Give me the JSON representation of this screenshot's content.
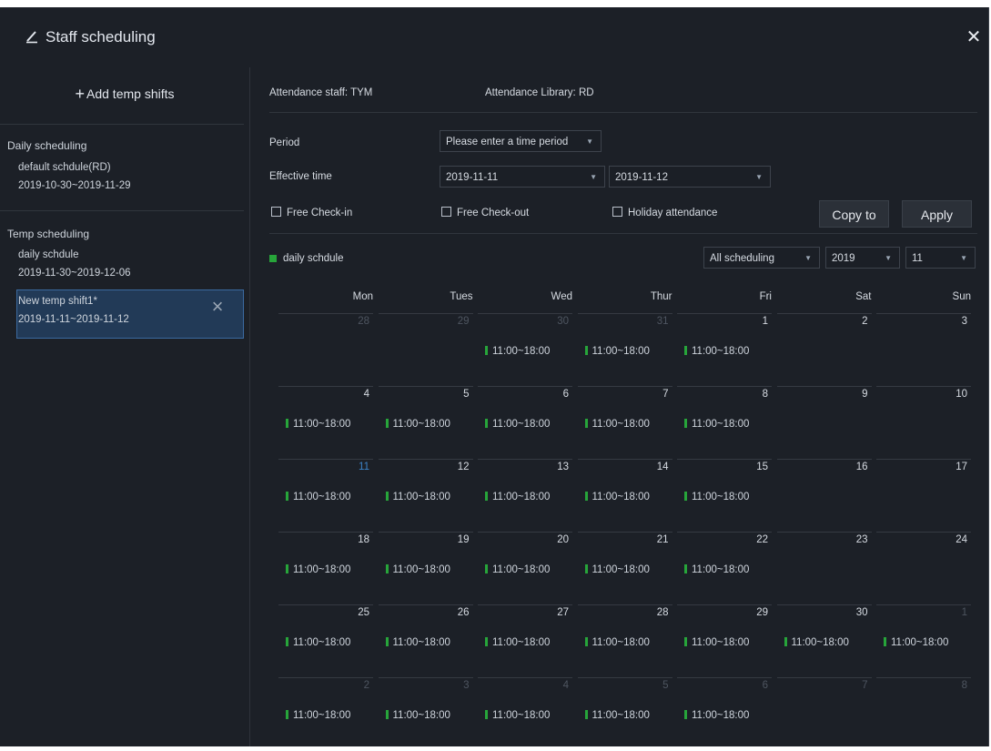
{
  "window": {
    "title": "Staff scheduling",
    "close_icon": "close-icon",
    "title_icon": "edit-icon"
  },
  "sidebar": {
    "add_temp_label": "Add temp shifts",
    "daily_heading": "Daily scheduling",
    "daily_items": [
      {
        "name": "default schdule(RD)",
        "range": "2019-10-30~2019-11-29"
      }
    ],
    "temp_heading": "Temp scheduling",
    "temp_items": [
      {
        "name": "daily schdule",
        "range": "2019-11-30~2019-12-06"
      },
      {
        "name": "New temp shift1*",
        "range": "2019-11-11~2019-11-12",
        "selected": true
      }
    ]
  },
  "main": {
    "attendance_staff_label": "Attendance staff:",
    "attendance_staff_value": "TYM",
    "attendance_library_label": "Attendance Library:",
    "attendance_library_value": "RD",
    "period_label": "Period",
    "period_placeholder": "Please enter a time period",
    "effective_label": "Effective time",
    "effective_start": "2019-11-11",
    "effective_end": "2019-11-12",
    "free_checkin": "Free Check-in",
    "free_checkout": "Free Check-out",
    "holiday_attendance": "Holiday attendance",
    "copy_to": "Copy to",
    "apply": "Apply",
    "legend_label": "daily schdule",
    "filter_scheduling": "All scheduling",
    "filter_year": "2019",
    "filter_month": "11",
    "accent_color": "#27a53a",
    "today_color": "#3c83c8"
  },
  "calendar": {
    "weekdays": [
      "Mon",
      "Tues",
      "Wed",
      "Thur",
      "Fri",
      "Sat",
      "Sun"
    ],
    "weeks": [
      [
        {
          "day": "28",
          "other": true,
          "shift": ""
        },
        {
          "day": "29",
          "other": true,
          "shift": ""
        },
        {
          "day": "30",
          "other": true,
          "shift": "11:00~18:00"
        },
        {
          "day": "31",
          "other": true,
          "shift": "11:00~18:00"
        },
        {
          "day": "1",
          "other": false,
          "shift": "11:00~18:00"
        },
        {
          "day": "2",
          "other": false,
          "shift": ""
        },
        {
          "day": "3",
          "other": false,
          "shift": ""
        }
      ],
      [
        {
          "day": "4",
          "other": false,
          "shift": "11:00~18:00"
        },
        {
          "day": "5",
          "other": false,
          "shift": "11:00~18:00"
        },
        {
          "day": "6",
          "other": false,
          "shift": "11:00~18:00"
        },
        {
          "day": "7",
          "other": false,
          "shift": "11:00~18:00"
        },
        {
          "day": "8",
          "other": false,
          "shift": "11:00~18:00"
        },
        {
          "day": "9",
          "other": false,
          "shift": ""
        },
        {
          "day": "10",
          "other": false,
          "shift": ""
        }
      ],
      [
        {
          "day": "11",
          "other": false,
          "today": true,
          "shift": "11:00~18:00"
        },
        {
          "day": "12",
          "other": false,
          "shift": "11:00~18:00"
        },
        {
          "day": "13",
          "other": false,
          "shift": "11:00~18:00"
        },
        {
          "day": "14",
          "other": false,
          "shift": "11:00~18:00"
        },
        {
          "day": "15",
          "other": false,
          "shift": "11:00~18:00"
        },
        {
          "day": "16",
          "other": false,
          "shift": ""
        },
        {
          "day": "17",
          "other": false,
          "shift": ""
        }
      ],
      [
        {
          "day": "18",
          "other": false,
          "shift": "11:00~18:00"
        },
        {
          "day": "19",
          "other": false,
          "shift": "11:00~18:00"
        },
        {
          "day": "20",
          "other": false,
          "shift": "11:00~18:00"
        },
        {
          "day": "21",
          "other": false,
          "shift": "11:00~18:00"
        },
        {
          "day": "22",
          "other": false,
          "shift": "11:00~18:00"
        },
        {
          "day": "23",
          "other": false,
          "shift": ""
        },
        {
          "day": "24",
          "other": false,
          "shift": ""
        }
      ],
      [
        {
          "day": "25",
          "other": false,
          "shift": "11:00~18:00"
        },
        {
          "day": "26",
          "other": false,
          "shift": "11:00~18:00"
        },
        {
          "day": "27",
          "other": false,
          "shift": "11:00~18:00"
        },
        {
          "day": "28",
          "other": false,
          "shift": "11:00~18:00"
        },
        {
          "day": "29",
          "other": false,
          "shift": "11:00~18:00"
        },
        {
          "day": "30",
          "other": false,
          "shift": "11:00~18:00"
        },
        {
          "day": "1",
          "other": true,
          "shift": "11:00~18:00"
        }
      ],
      [
        {
          "day": "2",
          "other": true,
          "shift": "11:00~18:00"
        },
        {
          "day": "3",
          "other": true,
          "shift": "11:00~18:00"
        },
        {
          "day": "4",
          "other": true,
          "shift": "11:00~18:00"
        },
        {
          "day": "5",
          "other": true,
          "shift": "11:00~18:00"
        },
        {
          "day": "6",
          "other": true,
          "shift": "11:00~18:00"
        },
        {
          "day": "7",
          "other": true,
          "shift": ""
        },
        {
          "day": "8",
          "other": true,
          "shift": ""
        }
      ]
    ]
  }
}
